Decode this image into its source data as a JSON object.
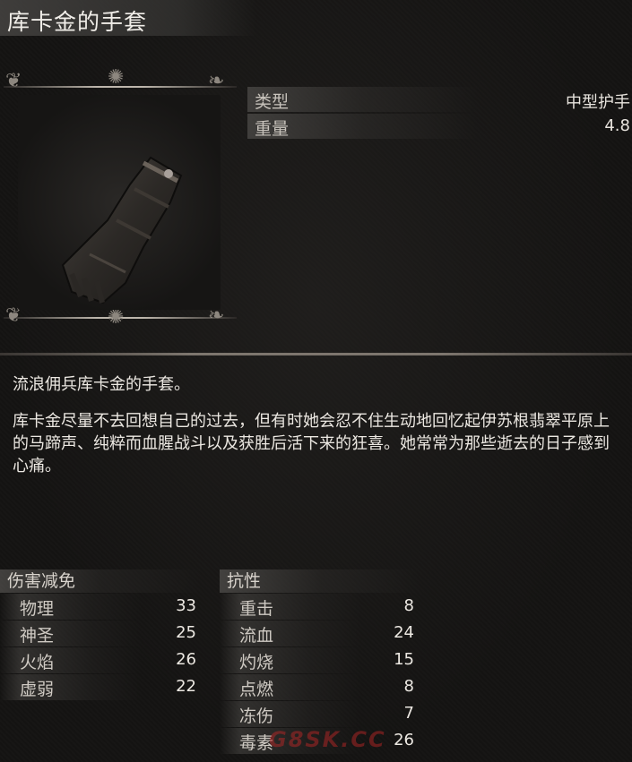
{
  "item": {
    "name": "库卡金的手套"
  },
  "stats": [
    {
      "label": "类型",
      "value": "中型护手"
    },
    {
      "label": "重量",
      "value": "4.8"
    }
  ],
  "description": {
    "line1": "流浪佣兵库卡金的手套。",
    "line2": "库卡金尽量不去回想自己的过去，但有时她会忍不住生动地回忆起伊苏根翡翠平原上的马蹄声、纯粹而血腥战斗以及获胜后活下来的狂喜。她常常为那些逝去的日子感到心痛。"
  },
  "damage_reduction": {
    "header": "伤害减免",
    "rows": [
      {
        "label": "物理",
        "value": "33"
      },
      {
        "label": "神圣",
        "value": "25"
      },
      {
        "label": "火焰",
        "value": "26"
      },
      {
        "label": "虚弱",
        "value": "22"
      }
    ]
  },
  "resistance": {
    "header": "抗性",
    "rows": [
      {
        "label": "重击",
        "value": "8"
      },
      {
        "label": "流血",
        "value": "24"
      },
      {
        "label": "灼烧",
        "value": "15"
      },
      {
        "label": "点燃",
        "value": "8"
      },
      {
        "label": "冻伤",
        "value": "7"
      },
      {
        "label": "毒素",
        "value": "26"
      }
    ]
  },
  "watermark": "G8SK.CC",
  "icons": {
    "item_image": "gauntlet-icon",
    "frame_ornament": "filigree-ornament-icon"
  }
}
